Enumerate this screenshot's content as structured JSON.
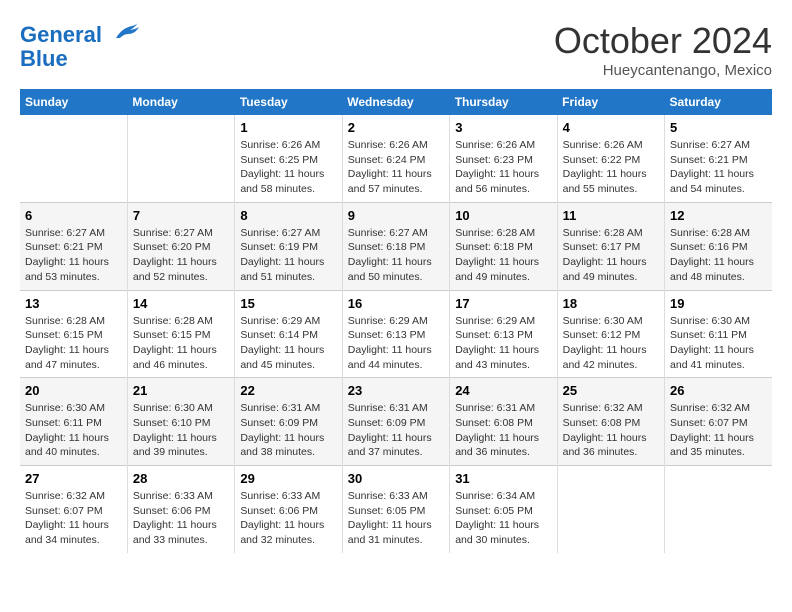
{
  "logo": {
    "line1": "General",
    "line2": "Blue"
  },
  "title": "October 2024",
  "location": "Hueycantenango, Mexico",
  "days_of_week": [
    "Sunday",
    "Monday",
    "Tuesday",
    "Wednesday",
    "Thursday",
    "Friday",
    "Saturday"
  ],
  "weeks": [
    [
      {
        "day": "",
        "sunrise": "",
        "sunset": "",
        "daylight": ""
      },
      {
        "day": "",
        "sunrise": "",
        "sunset": "",
        "daylight": ""
      },
      {
        "day": "1",
        "sunrise": "Sunrise: 6:26 AM",
        "sunset": "Sunset: 6:25 PM",
        "daylight": "Daylight: 11 hours and 58 minutes."
      },
      {
        "day": "2",
        "sunrise": "Sunrise: 6:26 AM",
        "sunset": "Sunset: 6:24 PM",
        "daylight": "Daylight: 11 hours and 57 minutes."
      },
      {
        "day": "3",
        "sunrise": "Sunrise: 6:26 AM",
        "sunset": "Sunset: 6:23 PM",
        "daylight": "Daylight: 11 hours and 56 minutes."
      },
      {
        "day": "4",
        "sunrise": "Sunrise: 6:26 AM",
        "sunset": "Sunset: 6:22 PM",
        "daylight": "Daylight: 11 hours and 55 minutes."
      },
      {
        "day": "5",
        "sunrise": "Sunrise: 6:27 AM",
        "sunset": "Sunset: 6:21 PM",
        "daylight": "Daylight: 11 hours and 54 minutes."
      }
    ],
    [
      {
        "day": "6",
        "sunrise": "Sunrise: 6:27 AM",
        "sunset": "Sunset: 6:21 PM",
        "daylight": "Daylight: 11 hours and 53 minutes."
      },
      {
        "day": "7",
        "sunrise": "Sunrise: 6:27 AM",
        "sunset": "Sunset: 6:20 PM",
        "daylight": "Daylight: 11 hours and 52 minutes."
      },
      {
        "day": "8",
        "sunrise": "Sunrise: 6:27 AM",
        "sunset": "Sunset: 6:19 PM",
        "daylight": "Daylight: 11 hours and 51 minutes."
      },
      {
        "day": "9",
        "sunrise": "Sunrise: 6:27 AM",
        "sunset": "Sunset: 6:18 PM",
        "daylight": "Daylight: 11 hours and 50 minutes."
      },
      {
        "day": "10",
        "sunrise": "Sunrise: 6:28 AM",
        "sunset": "Sunset: 6:18 PM",
        "daylight": "Daylight: 11 hours and 49 minutes."
      },
      {
        "day": "11",
        "sunrise": "Sunrise: 6:28 AM",
        "sunset": "Sunset: 6:17 PM",
        "daylight": "Daylight: 11 hours and 49 minutes."
      },
      {
        "day": "12",
        "sunrise": "Sunrise: 6:28 AM",
        "sunset": "Sunset: 6:16 PM",
        "daylight": "Daylight: 11 hours and 48 minutes."
      }
    ],
    [
      {
        "day": "13",
        "sunrise": "Sunrise: 6:28 AM",
        "sunset": "Sunset: 6:15 PM",
        "daylight": "Daylight: 11 hours and 47 minutes."
      },
      {
        "day": "14",
        "sunrise": "Sunrise: 6:28 AM",
        "sunset": "Sunset: 6:15 PM",
        "daylight": "Daylight: 11 hours and 46 minutes."
      },
      {
        "day": "15",
        "sunrise": "Sunrise: 6:29 AM",
        "sunset": "Sunset: 6:14 PM",
        "daylight": "Daylight: 11 hours and 45 minutes."
      },
      {
        "day": "16",
        "sunrise": "Sunrise: 6:29 AM",
        "sunset": "Sunset: 6:13 PM",
        "daylight": "Daylight: 11 hours and 44 minutes."
      },
      {
        "day": "17",
        "sunrise": "Sunrise: 6:29 AM",
        "sunset": "Sunset: 6:13 PM",
        "daylight": "Daylight: 11 hours and 43 minutes."
      },
      {
        "day": "18",
        "sunrise": "Sunrise: 6:30 AM",
        "sunset": "Sunset: 6:12 PM",
        "daylight": "Daylight: 11 hours and 42 minutes."
      },
      {
        "day": "19",
        "sunrise": "Sunrise: 6:30 AM",
        "sunset": "Sunset: 6:11 PM",
        "daylight": "Daylight: 11 hours and 41 minutes."
      }
    ],
    [
      {
        "day": "20",
        "sunrise": "Sunrise: 6:30 AM",
        "sunset": "Sunset: 6:11 PM",
        "daylight": "Daylight: 11 hours and 40 minutes."
      },
      {
        "day": "21",
        "sunrise": "Sunrise: 6:30 AM",
        "sunset": "Sunset: 6:10 PM",
        "daylight": "Daylight: 11 hours and 39 minutes."
      },
      {
        "day": "22",
        "sunrise": "Sunrise: 6:31 AM",
        "sunset": "Sunset: 6:09 PM",
        "daylight": "Daylight: 11 hours and 38 minutes."
      },
      {
        "day": "23",
        "sunrise": "Sunrise: 6:31 AM",
        "sunset": "Sunset: 6:09 PM",
        "daylight": "Daylight: 11 hours and 37 minutes."
      },
      {
        "day": "24",
        "sunrise": "Sunrise: 6:31 AM",
        "sunset": "Sunset: 6:08 PM",
        "daylight": "Daylight: 11 hours and 36 minutes."
      },
      {
        "day": "25",
        "sunrise": "Sunrise: 6:32 AM",
        "sunset": "Sunset: 6:08 PM",
        "daylight": "Daylight: 11 hours and 36 minutes."
      },
      {
        "day": "26",
        "sunrise": "Sunrise: 6:32 AM",
        "sunset": "Sunset: 6:07 PM",
        "daylight": "Daylight: 11 hours and 35 minutes."
      }
    ],
    [
      {
        "day": "27",
        "sunrise": "Sunrise: 6:32 AM",
        "sunset": "Sunset: 6:07 PM",
        "daylight": "Daylight: 11 hours and 34 minutes."
      },
      {
        "day": "28",
        "sunrise": "Sunrise: 6:33 AM",
        "sunset": "Sunset: 6:06 PM",
        "daylight": "Daylight: 11 hours and 33 minutes."
      },
      {
        "day": "29",
        "sunrise": "Sunrise: 6:33 AM",
        "sunset": "Sunset: 6:06 PM",
        "daylight": "Daylight: 11 hours and 32 minutes."
      },
      {
        "day": "30",
        "sunrise": "Sunrise: 6:33 AM",
        "sunset": "Sunset: 6:05 PM",
        "daylight": "Daylight: 11 hours and 31 minutes."
      },
      {
        "day": "31",
        "sunrise": "Sunrise: 6:34 AM",
        "sunset": "Sunset: 6:05 PM",
        "daylight": "Daylight: 11 hours and 30 minutes."
      },
      {
        "day": "",
        "sunrise": "",
        "sunset": "",
        "daylight": ""
      },
      {
        "day": "",
        "sunrise": "",
        "sunset": "",
        "daylight": ""
      }
    ]
  ]
}
